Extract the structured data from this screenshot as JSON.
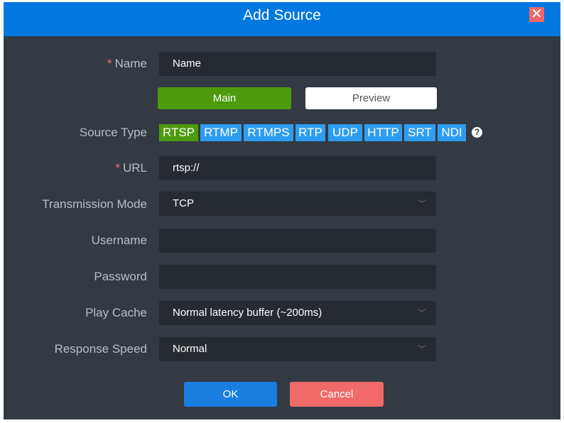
{
  "title": "Add Source",
  "close": "✕",
  "required_mark": "*",
  "name": {
    "label": "Name",
    "value": "Name"
  },
  "stream_tabs": {
    "main": "Main",
    "preview": "Preview"
  },
  "source_type": {
    "label": "Source Type",
    "options": [
      "RTSP",
      "RTMP",
      "RTMPS",
      "RTP",
      "UDP",
      "HTTP",
      "SRT",
      "NDI"
    ],
    "selected": "RTSP",
    "help": "?"
  },
  "url": {
    "label": "URL",
    "value": "rtsp://"
  },
  "transmission_mode": {
    "label": "Transmission Mode",
    "value": "TCP"
  },
  "username": {
    "label": "Username",
    "value": ""
  },
  "password": {
    "label": "Password",
    "value": ""
  },
  "play_cache": {
    "label": "Play Cache",
    "value": "Normal latency buffer (~200ms)"
  },
  "response_speed": {
    "label": "Response Speed",
    "value": "Normal"
  },
  "chevron": "﹀",
  "ok": "OK",
  "cancel": "Cancel"
}
